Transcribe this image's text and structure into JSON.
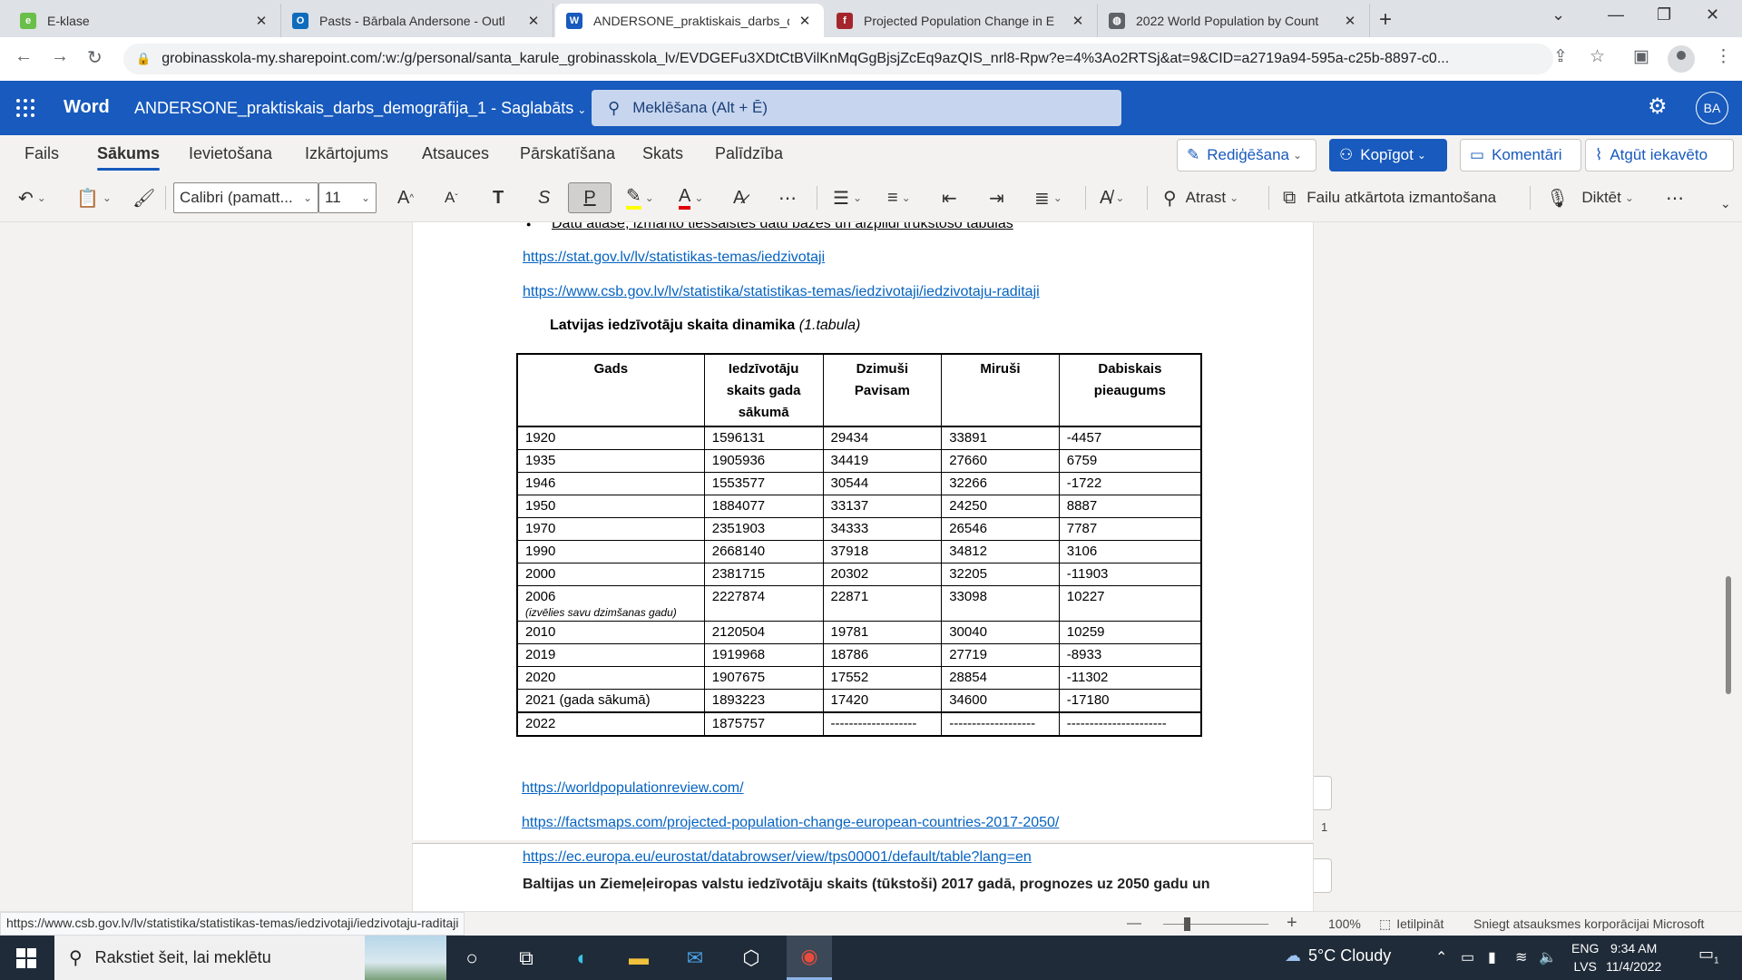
{
  "browser": {
    "tabs": [
      {
        "title": "E-klase",
        "icon": "eklase-icon",
        "color": "#6abf4b",
        "glyph": "e",
        "active": false
      },
      {
        "title": "Pasts - Bārbala Andersone - Outl",
        "icon": "outlook-icon",
        "color": "#0f6cbd",
        "glyph": "O",
        "active": false
      },
      {
        "title": "ANDERSONE_praktiskais_darbs_d",
        "icon": "word-icon",
        "color": "#185abd",
        "glyph": "W",
        "active": true
      },
      {
        "title": "Projected Population Change in E",
        "icon": "factsmaps-icon",
        "color": "#a4262c",
        "glyph": "f",
        "active": false
      },
      {
        "title": "2022 World Population by Count",
        "icon": "globe-icon",
        "color": "#5f6368",
        "glyph": "◍",
        "active": false
      }
    ],
    "new_tab": "+",
    "url": "grobinasskola-my.sharepoint.com/:w:/g/personal/santa_karule_grobinasskola_lv/EVDGEFu3XDtCtBVilKnMqGgBjsjZcEq9azQIS_nrl8-Rpw?e=4%3Ao2RTSj&at=9&CID=a2719a94-595a-c25b-8897-c0..."
  },
  "word": {
    "app_name": "Word",
    "doc_title": "ANDERSONE_praktiskais_darbs_demogrāfija_1  -  Saglabāts",
    "search_placeholder": "Meklēšana (Alt + Ē)",
    "user_initials": "BA",
    "menu_tabs": [
      "Fails",
      "Sākums",
      "Ievietošana",
      "Izkārtojums",
      "Atsauces",
      "Pārskatīšana",
      "Skats",
      "Palīdzība"
    ],
    "active_tab": "Sākums",
    "edit_button": "Rediģēšana",
    "share_button": "Kopīgot",
    "comments_button": "Komentāri",
    "catchup_button": "Atgūt iekavēto",
    "font_name": "Calibri (pamatt...",
    "font_size": "11",
    "find_label": "Atrast",
    "reuse_label": "Failu atkārtota izmantošana",
    "dictate_label": "Diktēt",
    "highlight_color": "#ffff00",
    "font_color": "#e00000"
  },
  "document": {
    "bullet_text": "Datu atlase, izmanto tiešsaistes datu bāzes un aizpildi trūkstošo tabulas",
    "links_top": [
      "https://stat.gov.lv/lv/statistikas-temas/iedzivotaji",
      "https://www.csb.gov.lv/lv/statistika/statistikas-temas/iedzivotaji/iedzivotaju-raditaji"
    ],
    "table_caption": "Latvijas iedzīvotāju skaita dinamika",
    "table_caption_note": "(1.tabula)",
    "table_headers": [
      "Gads",
      "Iedzīvotāju skaits gada sākumā",
      "Dzimuši Pavisam",
      "Miruši",
      "Dabiskais pieaugums"
    ],
    "table_rows": [
      {
        "year": "1920",
        "note": "",
        "pop": "1596131",
        "born": "29434",
        "died": "33891",
        "growth": "-4457"
      },
      {
        "year": "1935",
        "note": "",
        "pop": "1905936",
        "born": "34419",
        "died": "27660",
        "growth": "6759"
      },
      {
        "year": "1946",
        "note": "",
        "pop": "1553577",
        "born": "30544",
        "died": "32266",
        "growth": "-1722"
      },
      {
        "year": "1950",
        "note": "",
        "pop": "1884077",
        "born": "33137",
        "died": "24250",
        "growth": "8887"
      },
      {
        "year": "1970",
        "note": "",
        "pop": "2351903",
        "born": "34333",
        "died": "26546",
        "growth": "7787"
      },
      {
        "year": "1990",
        "note": "",
        "pop": "2668140",
        "born": "37918",
        "died": "34812",
        "growth": "3106"
      },
      {
        "year": "2000",
        "note": "",
        "pop": "2381715",
        "born": "20302",
        "died": "32205",
        "growth": "-11903"
      },
      {
        "year": "2006",
        "note": "(izvēlies savu dzimšanas gadu)",
        "pop": "2227874",
        "born": "22871",
        "died": "33098",
        "growth": "10227"
      },
      {
        "year": "2010",
        "note": "",
        "pop": "2120504",
        "born": "19781",
        "died": "30040",
        "growth": "10259"
      },
      {
        "year": "2019",
        "note": "",
        "pop": "1919968",
        "born": "18786",
        "died": "27719",
        "growth": "-8933"
      },
      {
        "year": "2020",
        "note": "",
        "pop": "1907675",
        "born": "17552",
        "died": "28854",
        "growth": "-11302"
      },
      {
        "year": "2021 (gada sākumā)",
        "note": "",
        "pop": "1893223",
        "born": "17420",
        "died": "34600",
        "growth": "-17180"
      },
      {
        "year": "2022",
        "note": "",
        "pop": "1875757",
        "born": "-------------------",
        "died": "-------------------",
        "growth": "----------------------"
      }
    ],
    "links_bottom": [
      "https://worldpopulationreview.com/",
      "https://factsmaps.com/projected-population-change-european-countries-2017-2050/",
      "https://ec.europa.eu/eurostat/databrowser/view/tps00001/default/table?lang=en"
    ],
    "heading_bottom": "Baltijas un Ziemeļeiropas valstu iedzīvotāju skaits (tūkstoši) 2017 gadā, prognozes uz 2050 gadu un",
    "page_number": "1"
  },
  "statusbar": {
    "hover_url": "https://www.csb.gov.lv/lv/statistika/statistikas-temas/iedzivotaji/iedzivotaju-raditaji",
    "zoom": "100%",
    "fit_label": "Ietilpināt",
    "feedback": "Sniegt atsauksmes korporācijai Microsoft"
  },
  "taskbar": {
    "search_placeholder": "Rakstiet šeit, lai meklētu",
    "weather": "5°C  Cloudy",
    "lang_top": "ENG",
    "lang_bottom": "LVS",
    "time": "9:34 AM",
    "date": "11/4/2022",
    "notification_count": "1"
  }
}
